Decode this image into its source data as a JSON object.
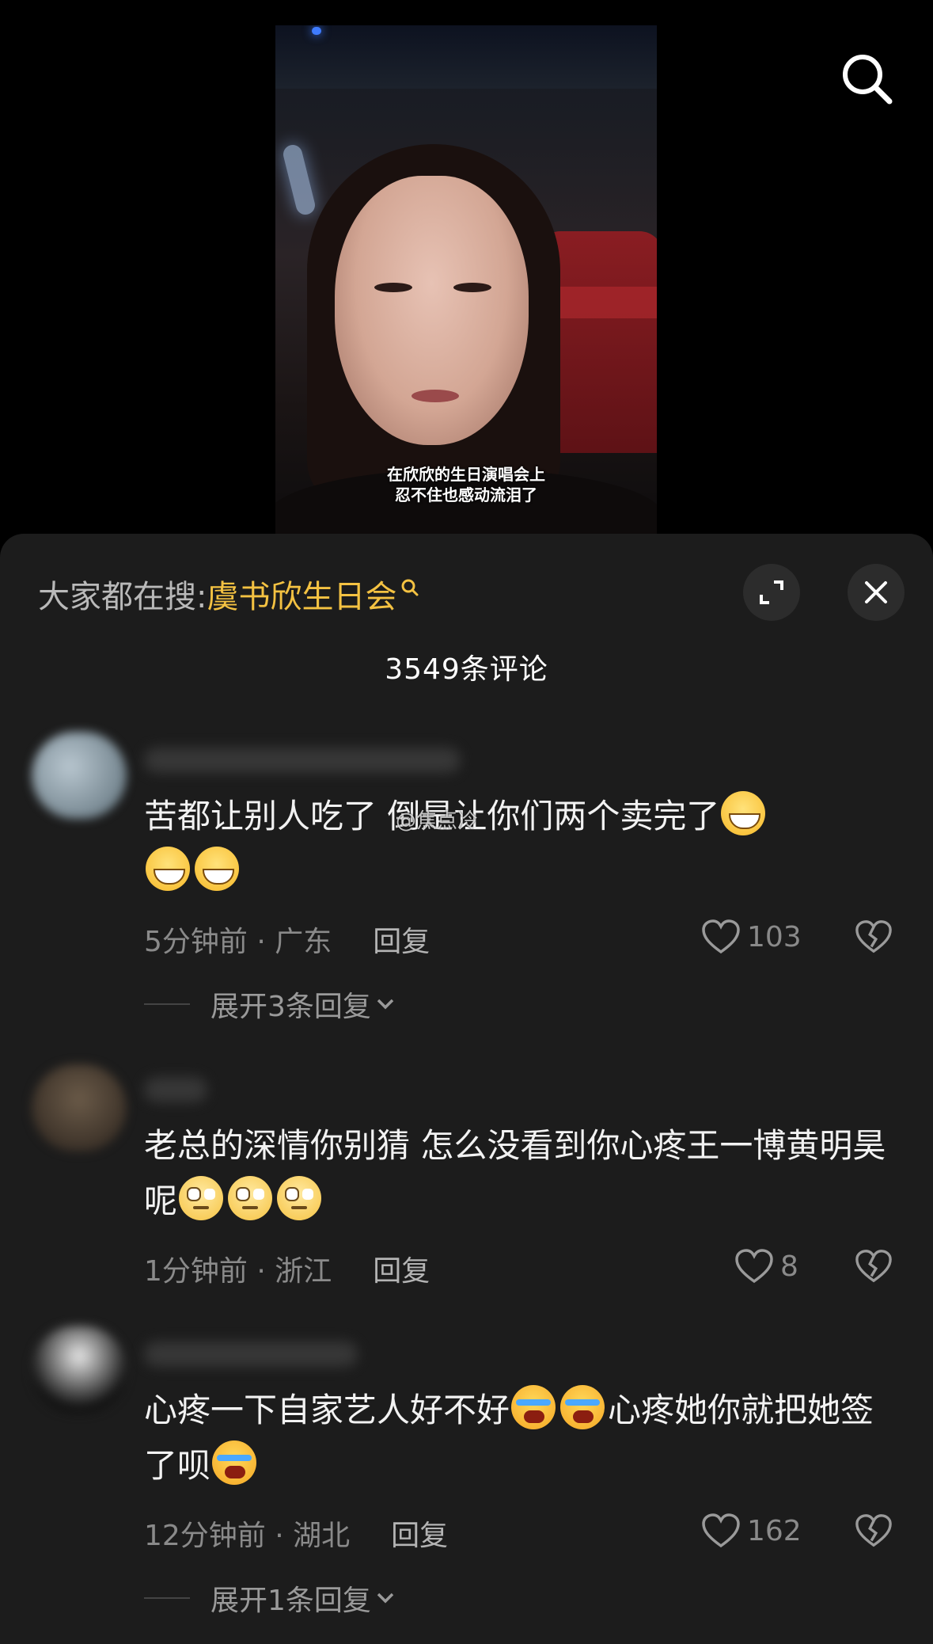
{
  "video": {
    "caption_line1": "在欣欣的生日演唱会上",
    "caption_line2": "忍不住也感动流泪了",
    "search_icon": "search-icon"
  },
  "sheet": {
    "hot_search_prefix": "大家都在搜:",
    "hot_search_term": "虞书欣生日会",
    "comment_count": "3549条评论",
    "colors": {
      "accent": "#f4c242",
      "background": "#1c1c1c"
    }
  },
  "comments": [
    {
      "text_a": "苦都让别人吃了 ",
      "text_b": "倒是让你们两个卖完了",
      "emojis": [
        "grin",
        "grin",
        "grin"
      ],
      "time_location": "5分钟前 · 广东",
      "reply": "回复",
      "likes": "103",
      "expand": "展开3条回复"
    },
    {
      "text": "老总的深情你别猜 怎么没看到你心疼王一博黄明昊呢",
      "emojis": [
        "roll",
        "roll",
        "roll"
      ],
      "time_location": "1分钟前 · 浙江",
      "reply": "回复",
      "likes": "8"
    },
    {
      "text_a": "心疼一下自家艺人好不好",
      "text_b": "心疼她你就把她签了呗",
      "emojis": [
        "cry",
        "cry",
        "cry"
      ],
      "time_location": "12分钟前 · 湖北",
      "reply": "回复",
      "likes": "162",
      "expand": "展开1条回复"
    }
  ],
  "watermark": "@焦点冷"
}
